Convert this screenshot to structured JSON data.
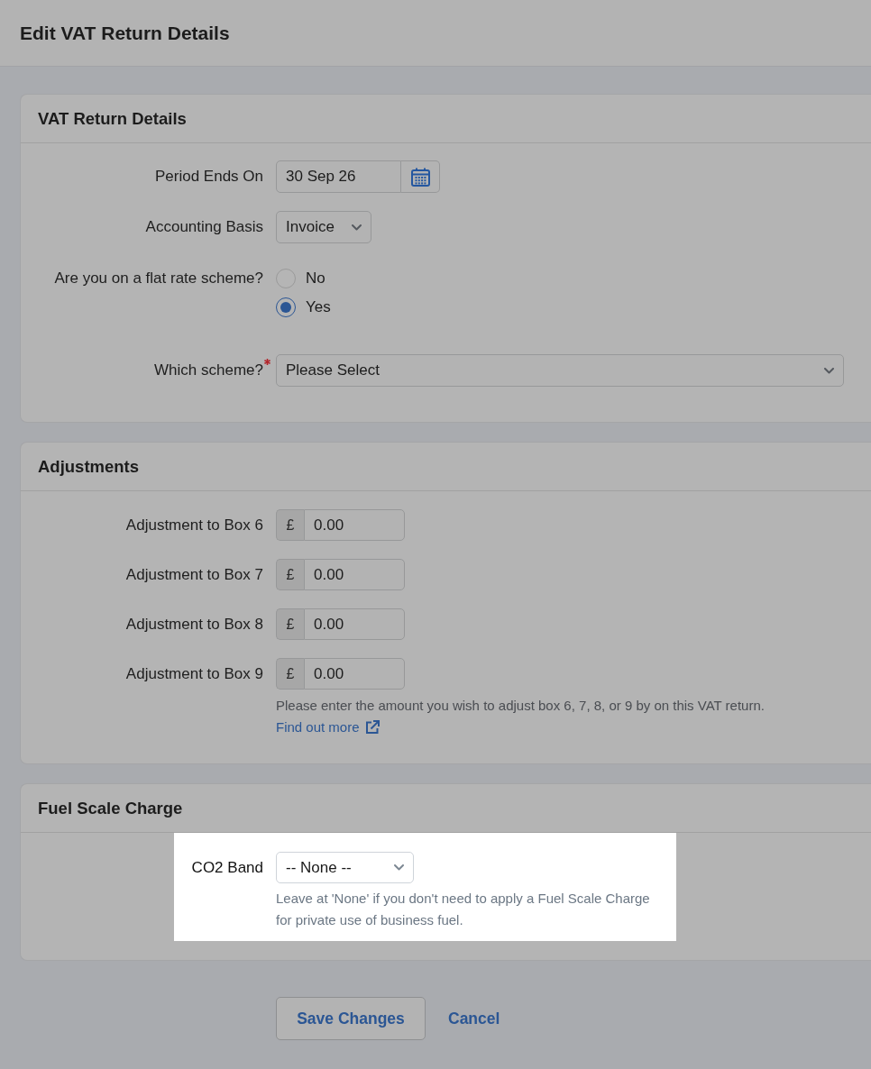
{
  "page": {
    "title": "Edit VAT Return Details"
  },
  "vat_return_details": {
    "title": "VAT Return Details",
    "period_ends_on": {
      "label": "Period Ends On",
      "value": "30 Sep 26"
    },
    "accounting_basis": {
      "label": "Accounting Basis",
      "value": "Invoice"
    },
    "flat_rate_scheme": {
      "label": "Are you on a flat rate scheme?",
      "options": [
        {
          "label": "No",
          "selected": false
        },
        {
          "label": "Yes",
          "selected": true
        }
      ]
    },
    "which_scheme": {
      "label": "Which scheme?",
      "required": true,
      "value": "Please Select"
    }
  },
  "adjustments": {
    "title": "Adjustments",
    "rows": [
      {
        "label": "Adjustment to Box 6",
        "currency": "£",
        "value": "0.00"
      },
      {
        "label": "Adjustment to Box 7",
        "currency": "£",
        "value": "0.00"
      },
      {
        "label": "Adjustment to Box 8",
        "currency": "£",
        "value": "0.00"
      },
      {
        "label": "Adjustment to Box 9",
        "currency": "£",
        "value": "0.00"
      }
    ],
    "help": "Please enter the amount you wish to adjust box 6, 7, 8, or 9 by on this VAT return.",
    "link": "Find out more"
  },
  "fuel_scale_charge": {
    "title": "Fuel Scale Charge",
    "co2_band": {
      "label": "CO2 Band",
      "value": "-- None --",
      "help": "Leave at 'None' if you don't need to apply a Fuel Scale Charge for private use of business fuel.",
      "highlighted": true
    }
  },
  "actions": [
    {
      "kind": "button",
      "label": "Save Changes"
    },
    {
      "kind": "link",
      "label": "Cancel"
    }
  ]
}
